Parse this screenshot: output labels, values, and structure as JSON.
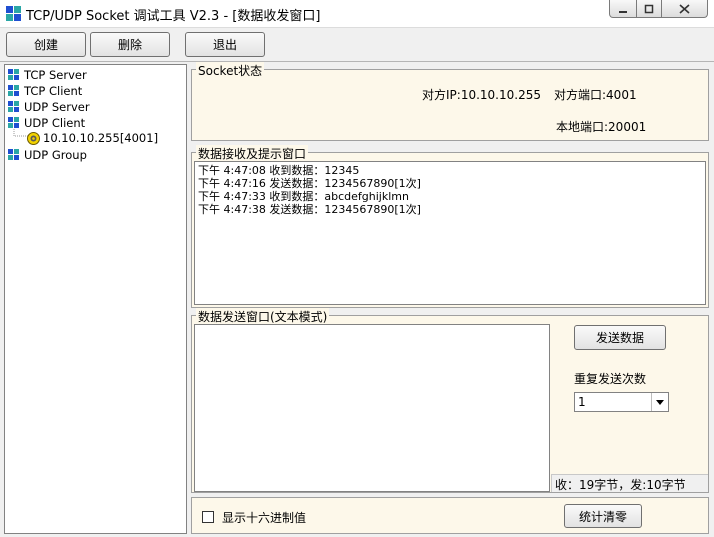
{
  "window": {
    "title": "TCP/UDP Socket 调试工具 V2.3 - [数据收发窗口]"
  },
  "toolbar": {
    "create_label": "创建",
    "delete_label": "删除",
    "exit_label": "退出"
  },
  "tree": {
    "items": [
      {
        "label": "TCP Server",
        "icon": "network-icon"
      },
      {
        "label": "TCP Client",
        "icon": "network-icon"
      },
      {
        "label": "UDP Server",
        "icon": "network-icon"
      },
      {
        "label": "UDP Client",
        "icon": "network-icon"
      },
      {
        "label": "10.10.10.255[4001]",
        "icon": "connection-icon"
      },
      {
        "label": "UDP Group",
        "icon": "network-icon"
      }
    ]
  },
  "socket_status": {
    "legend": "Socket状态",
    "remote_ip": "对方IP:10.10.10.255",
    "remote_port": "对方端口:4001",
    "local_port": "本地端口:20001"
  },
  "receive": {
    "legend": "数据接收及提示窗口",
    "lines": [
      "下午 4:47:08 收到数据：12345",
      "下午 4:47:16 发送数据：1234567890[1次]",
      "下午 4:47:33 收到数据：abcdefghijklmn",
      "下午 4:47:38 发送数据：1234567890[1次]"
    ]
  },
  "send": {
    "legend": "数据发送窗口(文本模式)",
    "text": "",
    "send_button_label": "发送数据",
    "repeat_label": "重复发送次数",
    "repeat_value": "1",
    "stats": "收：19字节，发:10字节"
  },
  "bottom": {
    "hex_checkbox_label": "显示十六进制值",
    "hex_checked": false,
    "reset_stats_label": "统计清零"
  },
  "colors": {
    "tree_icon_blue": "#1f4fd1",
    "tree_icon_teal": "#2aa6a6",
    "panel_bg": "#fdf8ea"
  }
}
